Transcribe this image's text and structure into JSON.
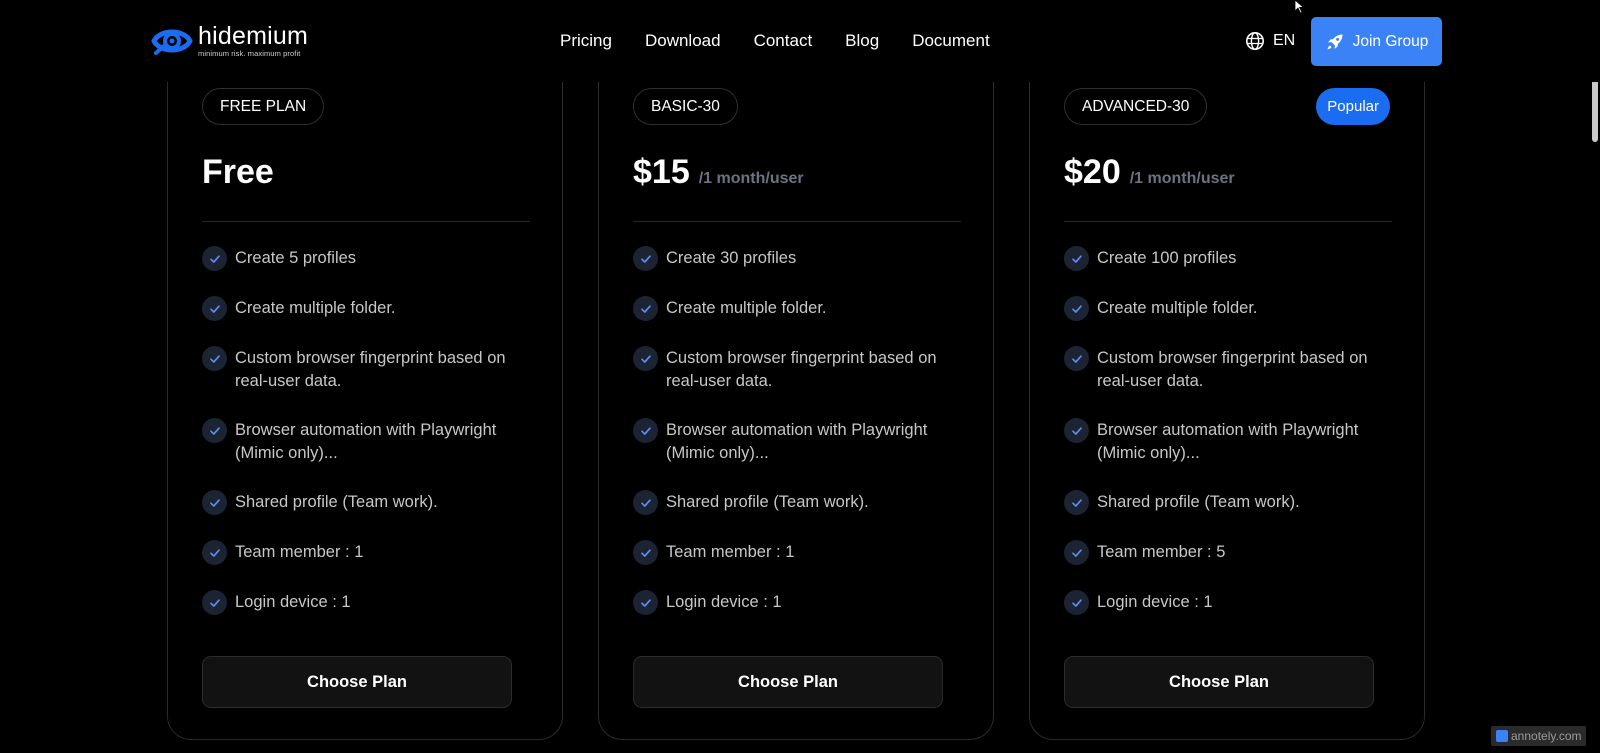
{
  "brand": {
    "name": "hidemium",
    "tagline": "minimum risk. maximum profit"
  },
  "nav": {
    "items": [
      {
        "label": "Pricing"
      },
      {
        "label": "Download"
      },
      {
        "label": "Contact"
      },
      {
        "label": "Blog"
      },
      {
        "label": "Document"
      }
    ]
  },
  "header": {
    "language": "EN",
    "join_label": "Join Group"
  },
  "plans": [
    {
      "name": "FREE PLAN",
      "price": "Free",
      "period": "",
      "badge": "",
      "features": [
        "Create 5 profiles",
        "Create multiple folder.",
        "Custom browser fingerprint based on real-user data.",
        "Browser automation with Playwright (Mimic only)...",
        "Shared profile (Team work).",
        "Team member : 1",
        "Login device : 1"
      ],
      "cta": "Choose Plan"
    },
    {
      "name": "BASIC-30",
      "price": "$15",
      "period": "/1 month/user",
      "badge": "",
      "features": [
        "Create 30 profiles",
        "Create multiple folder.",
        "Custom browser fingerprint based on real-user data.",
        "Browser automation with Playwright (Mimic only)...",
        "Shared profile (Team work).",
        "Team member : 1",
        "Login device : 1"
      ],
      "cta": "Choose Plan"
    },
    {
      "name": "ADVANCED-30",
      "price": "$20",
      "period": "/1 month/user",
      "badge": "Popular",
      "features": [
        "Create 100 profiles",
        "Create multiple folder.",
        "Custom browser fingerprint based on real-user data.",
        "Browser automation with Playwright (Mimic only)...",
        "Shared profile (Team work).",
        "Team member : 5",
        "Login device : 1"
      ],
      "cta": "Choose Plan"
    }
  ],
  "watermark": "annotely.com",
  "colors": {
    "background": "#000000",
    "accent": "#3b82f6",
    "popular": "#1a6df0",
    "muted_text": "#6b7280",
    "feature_text": "#c7c7c7"
  },
  "icons": {
    "logo": "eye-logo-icon",
    "language": "globe-icon",
    "join": "rocket-icon",
    "feature": "check-circle-icon"
  }
}
